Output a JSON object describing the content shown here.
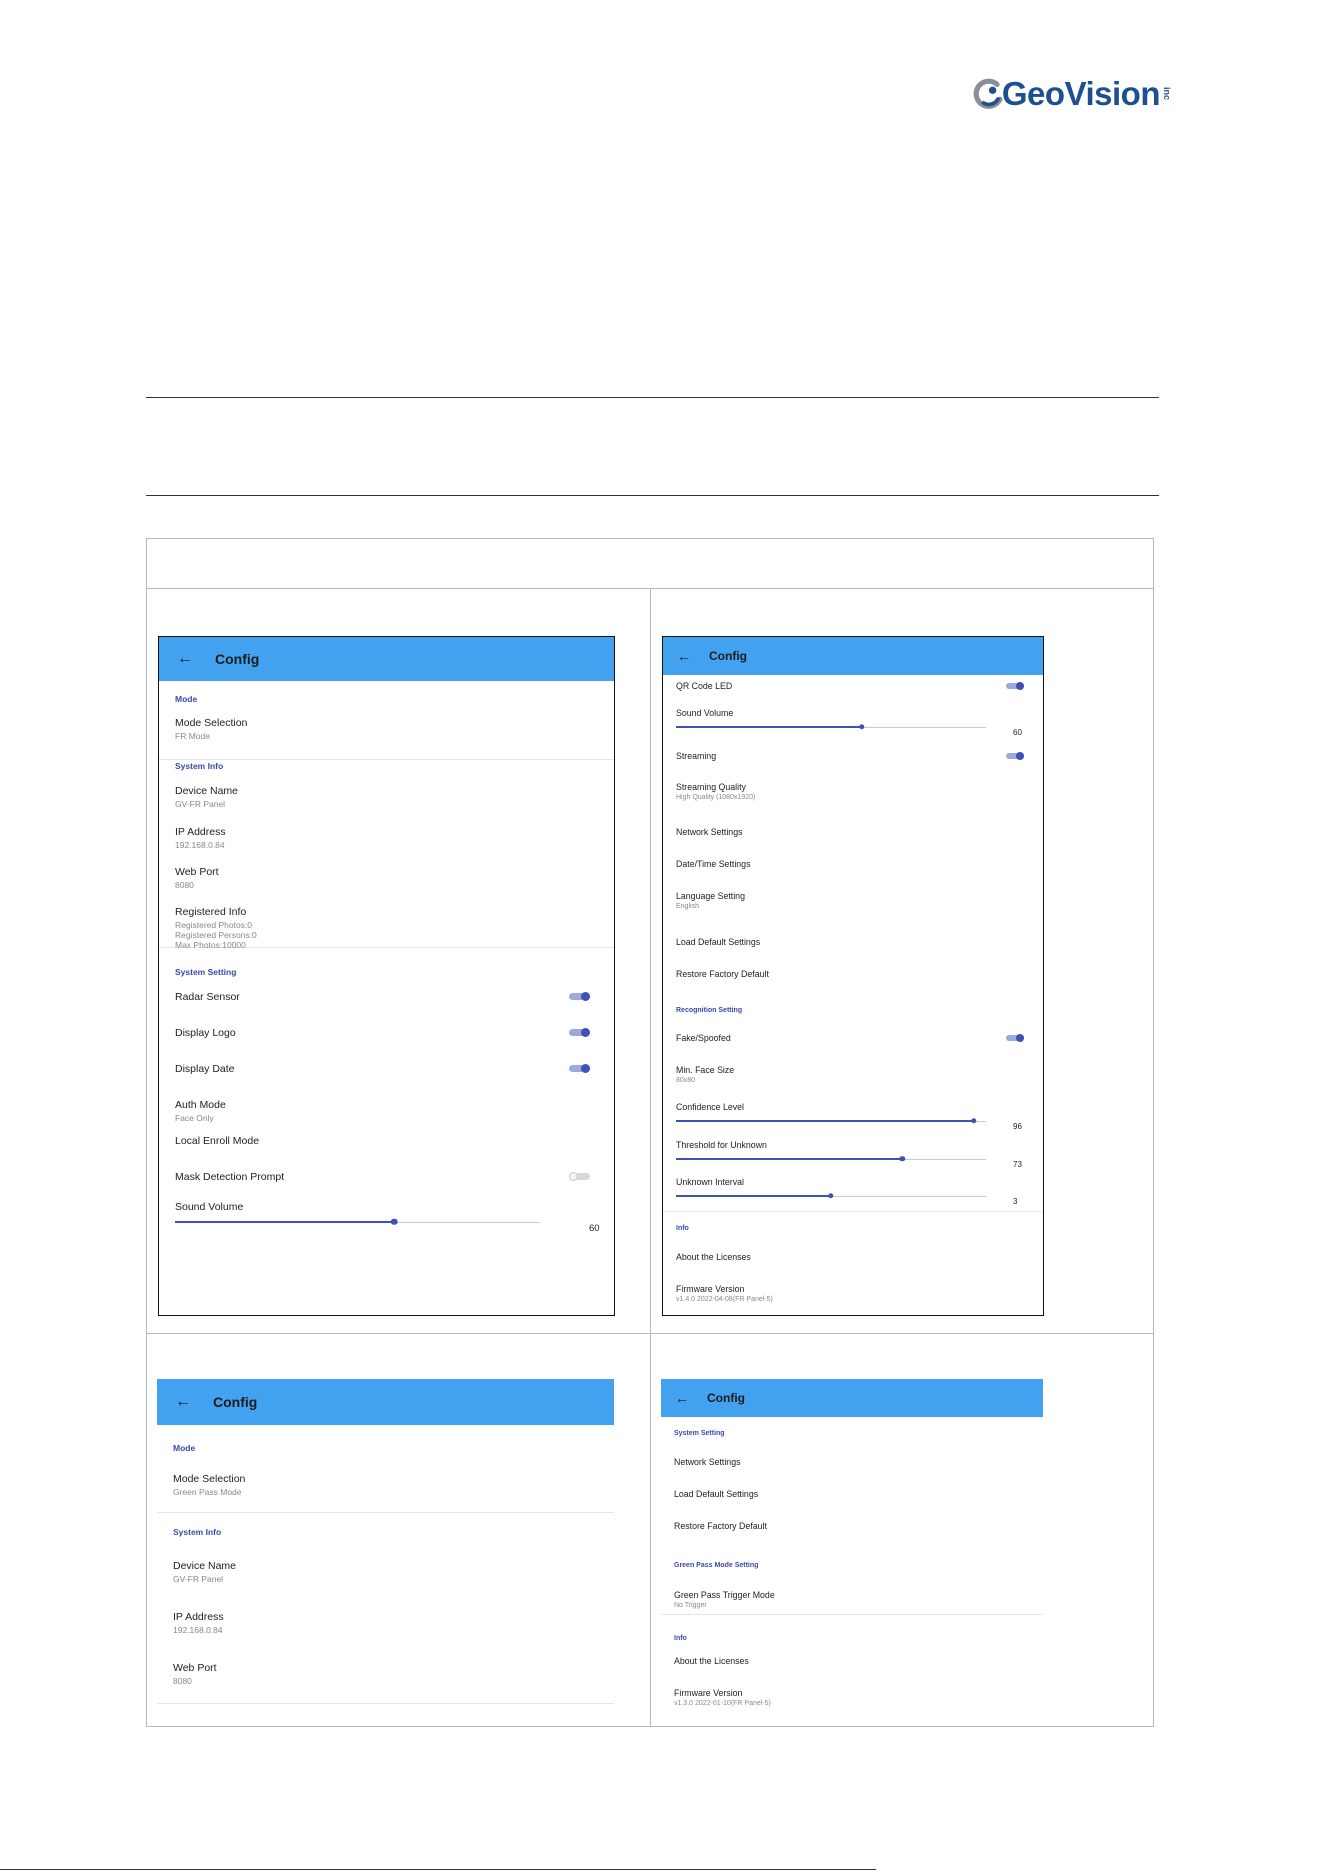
{
  "logo": {
    "text": "GeoVision",
    "suffix": "inc",
    "brand_color": "#1d4f91"
  },
  "colors": {
    "appbar": "#42a2ef",
    "accent": "#3f51b5",
    "section": "#3949ab"
  },
  "screens": {
    "s1": {
      "title": "Config",
      "back_icon": "←",
      "items": [
        {
          "k": "section",
          "text": "Mode"
        },
        {
          "k": "item",
          "label": "Mode Selection",
          "sub": "FR Mode"
        },
        {
          "k": "section",
          "text": "System Info"
        },
        {
          "k": "item",
          "label": "Device Name",
          "sub": "GV-FR Panel"
        },
        {
          "k": "item",
          "label": "IP Address",
          "sub": "192.168.0.84"
        },
        {
          "k": "item",
          "label": "Web Port",
          "sub": "8080"
        },
        {
          "k": "item",
          "label": "Registered Info",
          "sub": "Registered Photos:0",
          "sub2": "Registered Persons:0",
          "sub3": "Max Photos:10000"
        },
        {
          "k": "section",
          "text": "System Setting"
        },
        {
          "k": "toggle",
          "label": "Radar Sensor",
          "on": true
        },
        {
          "k": "toggle",
          "label": "Display Logo",
          "on": true
        },
        {
          "k": "toggle",
          "label": "Display Date",
          "on": true
        },
        {
          "k": "item",
          "label": "Auth Mode",
          "sub": "Face Only"
        },
        {
          "k": "item",
          "label": "Local Enroll Mode"
        },
        {
          "k": "toggle",
          "label": "Mask Detection Prompt",
          "on": false
        },
        {
          "k": "slider",
          "label": "Sound Volume",
          "value": "60",
          "pct": 60
        }
      ]
    },
    "s2": {
      "title": "Config",
      "back_icon": "←",
      "items": [
        {
          "k": "toggle",
          "label": "QR Code LED",
          "on": true
        },
        {
          "k": "slider",
          "label": "Sound Volume",
          "value": "60",
          "pct": 60
        },
        {
          "k": "toggle",
          "label": "Streaming",
          "on": true
        },
        {
          "k": "item",
          "label": "Streaming Quality",
          "sub": "High Quality (1080x1920)"
        },
        {
          "k": "item",
          "label": "Network Settings"
        },
        {
          "k": "item",
          "label": "Date/Time Settings"
        },
        {
          "k": "item",
          "label": "Language Setting",
          "sub": "English"
        },
        {
          "k": "item",
          "label": "Load Default Settings"
        },
        {
          "k": "item",
          "label": "Restore Factory Default"
        },
        {
          "k": "section",
          "text": "Recognition Setting"
        },
        {
          "k": "toggle",
          "label": "Fake/Spoofed",
          "on": true
        },
        {
          "k": "item",
          "label": "Min. Face Size",
          "sub": "80x80"
        },
        {
          "k": "slider",
          "label": "Confidence Level",
          "value": "96",
          "pct": 96
        },
        {
          "k": "slider",
          "label": "Threshold for Unknown",
          "value": "73",
          "pct": 73
        },
        {
          "k": "slider",
          "label": "Unknown Interval",
          "value": "3",
          "pct": 50
        },
        {
          "k": "section",
          "text": "Info"
        },
        {
          "k": "item",
          "label": "About the Licenses"
        },
        {
          "k": "item",
          "label": "Firmware Version",
          "sub": "v1.4.0 2022-04-08(FR Panel-5)"
        }
      ]
    },
    "s3": {
      "title": "Config",
      "back_icon": "←",
      "items": [
        {
          "k": "section",
          "text": "Mode"
        },
        {
          "k": "item",
          "label": "Mode Selection",
          "sub": "Green Pass Mode"
        },
        {
          "k": "section",
          "text": "System Info"
        },
        {
          "k": "item",
          "label": "Device Name",
          "sub": "GV-FR Panel"
        },
        {
          "k": "item",
          "label": "IP Address",
          "sub": "192.168.0.84"
        },
        {
          "k": "item",
          "label": "Web Port",
          "sub": "8080"
        }
      ]
    },
    "s4": {
      "title": "Config",
      "back_icon": "←",
      "items": [
        {
          "k": "section",
          "text": "System Setting"
        },
        {
          "k": "item",
          "label": "Network Settings"
        },
        {
          "k": "item",
          "label": "Load Default Settings"
        },
        {
          "k": "item",
          "label": "Restore Factory Default"
        },
        {
          "k": "section",
          "text": "Green Pass Mode Setting"
        },
        {
          "k": "item",
          "label": "Green Pass Trigger Mode",
          "sub": "No Trigger"
        },
        {
          "k": "section",
          "text": "Info"
        },
        {
          "k": "item",
          "label": "About the Licenses"
        },
        {
          "k": "item",
          "label": "Firmware Version",
          "sub": "v1.3.0 2022-01-10(FR Panel-5)"
        }
      ]
    }
  }
}
